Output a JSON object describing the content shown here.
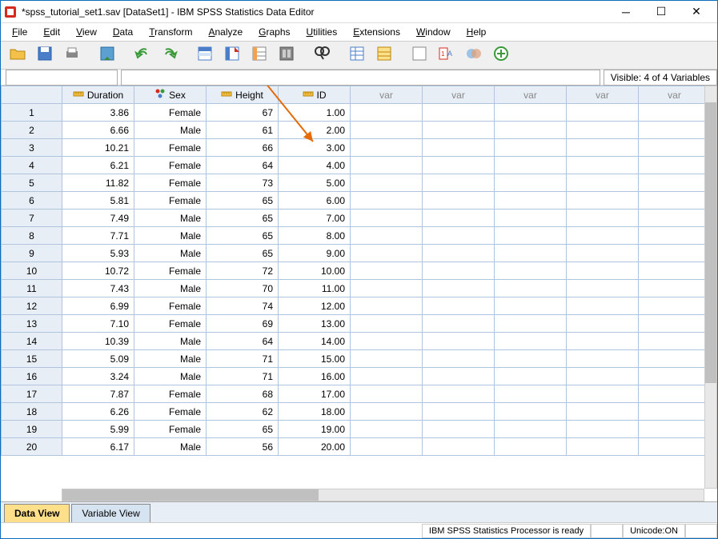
{
  "window": {
    "title": "*spss_tutorial_set1.sav [DataSet1] - IBM SPSS Statistics Data Editor"
  },
  "menu": [
    "File",
    "Edit",
    "View",
    "Data",
    "Transform",
    "Analyze",
    "Graphs",
    "Utilities",
    "Extensions",
    "Window",
    "Help"
  ],
  "toolbar_icons": [
    "open-file-icon",
    "save-icon",
    "print-icon",
    "recall-dialog-icon",
    "undo-icon",
    "redo-icon",
    "goto-case-icon",
    "goto-variable-icon",
    "variables-icon",
    "run-icon",
    "find-icon",
    "split-file-icon",
    "weight-cases-icon",
    "select-cases-icon",
    "value-labels-icon",
    "use-sets-icon",
    "add-icon"
  ],
  "infobar": {
    "visible": "Visible: 4 of 4 Variables"
  },
  "columns": [
    {
      "name": "Duration",
      "icon": "ruler-icon"
    },
    {
      "name": "Sex",
      "icon": "nominal-icon"
    },
    {
      "name": "Height",
      "icon": "ruler-icon"
    },
    {
      "name": "ID",
      "icon": "ruler-icon"
    }
  ],
  "var_label": "var",
  "rows": [
    {
      "n": 1,
      "Duration": "3.86",
      "Sex": "Female",
      "Height": "67",
      "ID": "1.00"
    },
    {
      "n": 2,
      "Duration": "6.66",
      "Sex": "Male",
      "Height": "61",
      "ID": "2.00"
    },
    {
      "n": 3,
      "Duration": "10.21",
      "Sex": "Female",
      "Height": "66",
      "ID": "3.00"
    },
    {
      "n": 4,
      "Duration": "6.21",
      "Sex": "Female",
      "Height": "64",
      "ID": "4.00"
    },
    {
      "n": 5,
      "Duration": "11.82",
      "Sex": "Female",
      "Height": "73",
      "ID": "5.00"
    },
    {
      "n": 6,
      "Duration": "5.81",
      "Sex": "Female",
      "Height": "65",
      "ID": "6.00"
    },
    {
      "n": 7,
      "Duration": "7.49",
      "Sex": "Male",
      "Height": "65",
      "ID": "7.00"
    },
    {
      "n": 8,
      "Duration": "7.71",
      "Sex": "Male",
      "Height": "65",
      "ID": "8.00"
    },
    {
      "n": 9,
      "Duration": "5.93",
      "Sex": "Male",
      "Height": "65",
      "ID": "9.00"
    },
    {
      "n": 10,
      "Duration": "10.72",
      "Sex": "Female",
      "Height": "72",
      "ID": "10.00"
    },
    {
      "n": 11,
      "Duration": "7.43",
      "Sex": "Male",
      "Height": "70",
      "ID": "11.00"
    },
    {
      "n": 12,
      "Duration": "6.99",
      "Sex": "Female",
      "Height": "74",
      "ID": "12.00"
    },
    {
      "n": 13,
      "Duration": "7.10",
      "Sex": "Female",
      "Height": "69",
      "ID": "13.00"
    },
    {
      "n": 14,
      "Duration": "10.39",
      "Sex": "Male",
      "Height": "64",
      "ID": "14.00"
    },
    {
      "n": 15,
      "Duration": "5.09",
      "Sex": "Male",
      "Height": "71",
      "ID": "15.00"
    },
    {
      "n": 16,
      "Duration": "3.24",
      "Sex": "Male",
      "Height": "71",
      "ID": "16.00"
    },
    {
      "n": 17,
      "Duration": "7.87",
      "Sex": "Female",
      "Height": "68",
      "ID": "17.00"
    },
    {
      "n": 18,
      "Duration": "6.26",
      "Sex": "Female",
      "Height": "62",
      "ID": "18.00"
    },
    {
      "n": 19,
      "Duration": "5.99",
      "Sex": "Female",
      "Height": "65",
      "ID": "19.00"
    },
    {
      "n": 20,
      "Duration": "6.17",
      "Sex": "Male",
      "Height": "56",
      "ID": "20.00"
    }
  ],
  "tabs": {
    "data_view": "Data View",
    "variable_view": "Variable View"
  },
  "status": {
    "processor": "IBM SPSS Statistics Processor is ready",
    "unicode": "Unicode:ON"
  }
}
